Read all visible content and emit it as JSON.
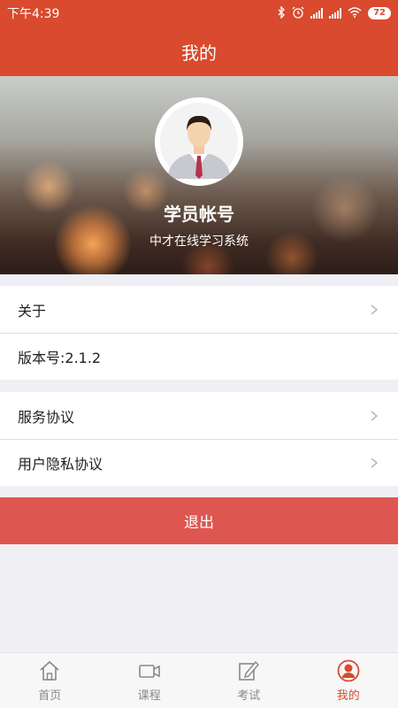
{
  "status_bar": {
    "time": "下午4:39",
    "battery": "72"
  },
  "title": "我的",
  "profile": {
    "name": "学员帐号",
    "subtitle": "中才在线学习系统"
  },
  "menu_group_1": [
    {
      "label": "关于",
      "has_arrow": true
    },
    {
      "label": "版本号:2.1.2",
      "has_arrow": false
    }
  ],
  "menu_group_2": [
    {
      "label": "服务协议",
      "has_arrow": true
    },
    {
      "label": "用户隐私协议",
      "has_arrow": true
    }
  ],
  "logout_label": "退出",
  "tabs": [
    {
      "label": "首页",
      "icon": "home-icon",
      "active": false
    },
    {
      "label": "课程",
      "icon": "video-camera-icon",
      "active": false
    },
    {
      "label": "考试",
      "icon": "edit-icon",
      "active": false
    },
    {
      "label": "我的",
      "icon": "user-icon",
      "active": true
    }
  ],
  "colors": {
    "brand": "#d94a2e",
    "logout": "#de5650",
    "tab_inactive": "#888888"
  }
}
